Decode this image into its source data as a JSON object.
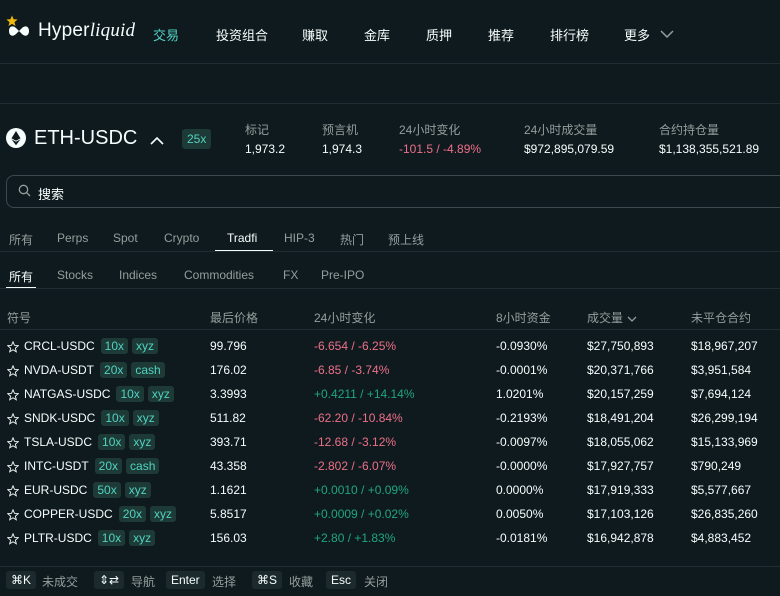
{
  "brand": {
    "name": "Hyper",
    "name_italic": "liquid"
  },
  "nav": [
    {
      "label": "交易",
      "active": true
    },
    {
      "label": "投资组合",
      "active": false
    },
    {
      "label": "赚取",
      "active": false
    },
    {
      "label": "金库",
      "active": false
    },
    {
      "label": "质押",
      "active": false
    },
    {
      "label": "推荐",
      "active": false
    },
    {
      "label": "排行榜",
      "active": false
    }
  ],
  "nav_more": "更多",
  "ticker": {
    "pair": "ETH-USDC",
    "leverage": "25x",
    "stats": [
      {
        "label": "标记",
        "value": "1,973.2"
      },
      {
        "label": "预言机",
        "value": "1,974.3"
      },
      {
        "label": "24小时变化",
        "value": "-101.5 / -4.89%"
      },
      {
        "label": "24小时成交量",
        "value": "$972,895,079.59"
      },
      {
        "label": "合约持仓量",
        "value": "$1,138,355,521.89"
      }
    ]
  },
  "search": {
    "placeholder": "搜索"
  },
  "categories": [
    "所有",
    "Perps",
    "Spot",
    "Crypto",
    "Tradfi",
    "HIP-3",
    "热门",
    "预上线"
  ],
  "active_category": "Tradfi",
  "subcategories": [
    "所有",
    "Stocks",
    "Indices",
    "Commodities",
    "FX",
    "Pre-IPO"
  ],
  "active_subcategory": "所有",
  "table": {
    "headers": [
      "符号",
      "最后价格",
      "24小时变化",
      "8小时资金",
      "成交量",
      "未平仓合约"
    ],
    "rows": [
      {
        "symbol": "CRCL-USDC",
        "lev": "10x",
        "tag": "xyz",
        "price": "99.796",
        "change": "-6.654 / -6.25%",
        "funding": "-0.0930%",
        "volume": "$27,750,893",
        "oi": "$18,967,207"
      },
      {
        "symbol": "NVDA-USDT",
        "lev": "20x",
        "tag": "cash",
        "price": "176.02",
        "change": "-6.85 / -3.74%",
        "funding": "-0.0001%",
        "volume": "$20,371,766",
        "oi": "$3,951,584"
      },
      {
        "symbol": "NATGAS-USDC",
        "lev": "10x",
        "tag": "xyz",
        "price": "3.3993",
        "change": "+0.4211 / +14.14%",
        "funding": "1.0201%",
        "volume": "$20,157,259",
        "oi": "$7,694,124"
      },
      {
        "symbol": "SNDK-USDC",
        "lev": "10x",
        "tag": "xyz",
        "price": "511.82",
        "change": "-62.20 / -10.84%",
        "funding": "-0.2193%",
        "volume": "$18,491,204",
        "oi": "$26,299,194"
      },
      {
        "symbol": "TSLA-USDC",
        "lev": "10x",
        "tag": "xyz",
        "price": "393.71",
        "change": "-12.68 / -3.12%",
        "funding": "-0.0097%",
        "volume": "$18,055,062",
        "oi": "$15,133,969"
      },
      {
        "symbol": "INTC-USDT",
        "lev": "20x",
        "tag": "cash",
        "price": "43.358",
        "change": "-2.802 / -6.07%",
        "funding": "-0.0000%",
        "volume": "$17,927,757",
        "oi": "$790,249"
      },
      {
        "symbol": "EUR-USDC",
        "lev": "50x",
        "tag": "xyz",
        "price": "1.1621",
        "change": "+0.0010 / +0.09%",
        "funding": "0.0000%",
        "volume": "$17,919,333",
        "oi": "$5,577,667"
      },
      {
        "symbol": "COPPER-USDC",
        "lev": "20x",
        "tag": "xyz",
        "price": "5.8517",
        "change": "+0.0009 / +0.02%",
        "funding": "0.0050%",
        "volume": "$17,103,126",
        "oi": "$26,835,260"
      },
      {
        "symbol": "PLTR-USDC",
        "lev": "10x",
        "tag": "xyz",
        "price": "156.03",
        "change": "+2.80 / +1.83%",
        "funding": "-0.0181%",
        "volume": "$16,942,878",
        "oi": "$4,883,452"
      }
    ]
  },
  "shortcuts": [
    {
      "key": "⌘K",
      "label": "未成交"
    },
    {
      "key": "⇕⇄",
      "label": "导航"
    },
    {
      "key": "Enter",
      "label": "选择"
    },
    {
      "key": "⌘S",
      "label": "收藏"
    },
    {
      "key": "Esc",
      "label": "关闭"
    }
  ],
  "colors": {
    "accent": "#50d2c1",
    "negative": "#ed7088",
    "positive": "#1fa67d",
    "background": "#0f1a1f"
  }
}
